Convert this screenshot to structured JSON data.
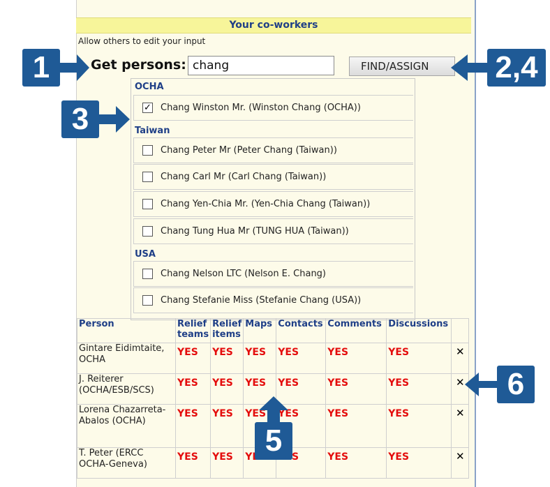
{
  "header": {
    "title": "Your co-workers"
  },
  "allow_text": "Allow others to edit your input",
  "search": {
    "label": "Get persons:",
    "value": "chang",
    "button": "FIND/ASSIGN"
  },
  "results": [
    {
      "group": "OCHA",
      "people": [
        {
          "label": "Chang Winston Mr. (Winston Chang (OCHA))",
          "checked": true
        }
      ]
    },
    {
      "group": "Taiwan",
      "people": [
        {
          "label": "Chang Peter Mr (Peter Chang (Taiwan))",
          "checked": false
        },
        {
          "label": "Chang Carl Mr (Carl Chang (Taiwan))",
          "checked": false
        },
        {
          "label": "Chang Yen-Chia Mr. (Yen-Chia Chang (Taiwan))",
          "checked": false
        },
        {
          "label": "Chang Tung Hua Mr (TUNG HUA (Taiwan))",
          "checked": false
        }
      ]
    },
    {
      "group": "USA",
      "people": [
        {
          "label": "Chang Nelson LTC (Nelson E. Chang)",
          "checked": false
        },
        {
          "label": "Chang Stefanie Miss (Stefanie Chang (USA))",
          "checked": false
        }
      ]
    }
  ],
  "table": {
    "headers": [
      "Person",
      "Relief teams",
      "Relief items",
      "Maps",
      "Contacts",
      "Comments",
      "Discussions"
    ],
    "rows": [
      {
        "person": "Gintare Eidimtaite, OCHA",
        "values": [
          "YES",
          "YES",
          "YES",
          "YES",
          "YES",
          "YES"
        ]
      },
      {
        "person": "J. Reiterer (OCHA/ESB/SCS)",
        "values": [
          "YES",
          "YES",
          "YES",
          "YES",
          "YES",
          "YES"
        ]
      },
      {
        "person": "Lorena Chazarreta-Abalos (OCHA)",
        "values": [
          "YES",
          "YES",
          "YES",
          "YES",
          "YES",
          "YES"
        ]
      },
      {
        "person": "T. Peter (ERCC OCHA-Geneva)",
        "values": [
          "YES",
          "YES",
          "YES",
          "YES",
          "YES",
          "YES"
        ]
      }
    ],
    "remove_symbol": "✕"
  },
  "markers": [
    "1",
    "2,4",
    "3",
    "5",
    "6"
  ],
  "colors": {
    "marker": "#1f5a96",
    "header_bg": "#f7f59a",
    "yes": "#e40d0d",
    "panel_bg": "#fdfbe9",
    "link": "#1f3f87"
  }
}
